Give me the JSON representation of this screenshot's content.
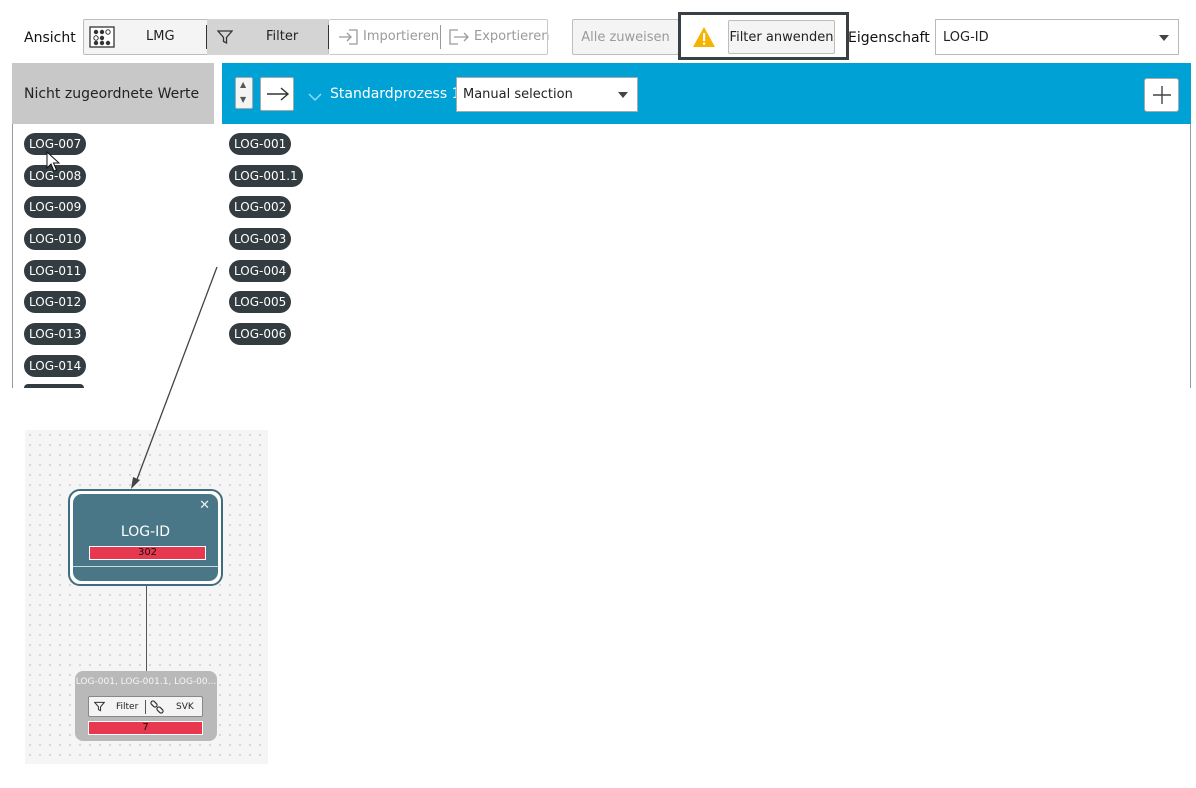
{
  "toolbar": {
    "view_label": "Ansicht",
    "lmg_label": "LMG",
    "filter_label": "Filter",
    "import_label": "Importieren",
    "export_label": "Exportieren",
    "assign_all_label": "Alle zuweisen",
    "apply_filter_label": "Filter anwenden",
    "property_label": "Eigenschaft",
    "property_value": "LOG-ID"
  },
  "left": {
    "header": "Nicht zugeordnete Werte",
    "chips": [
      "LOG-007",
      "LOG-008",
      "LOG-009",
      "LOG-010",
      "LOG-011",
      "LOG-012",
      "LOG-013",
      "LOG-014"
    ]
  },
  "process": {
    "name": "Standardprozess 1",
    "selection": "Manual selection",
    "chips": [
      "LOG-001",
      "LOG-001.1",
      "LOG-002",
      "LOG-003",
      "LOG-004",
      "LOG-005",
      "LOG-006"
    ]
  },
  "diagram": {
    "node_title": "LOG-ID",
    "node_count": "302",
    "child_title": "LOG-001, LOG-001.1, LOG-00...",
    "child_filter": "Filter",
    "child_svk": "SVK",
    "child_count": "7"
  },
  "colors": {
    "accent_blue": "#00a2d6",
    "chip_bg": "#333c40",
    "node_bg": "#4a7787",
    "count_red": "#e8384f",
    "warning": "#f5b400"
  }
}
